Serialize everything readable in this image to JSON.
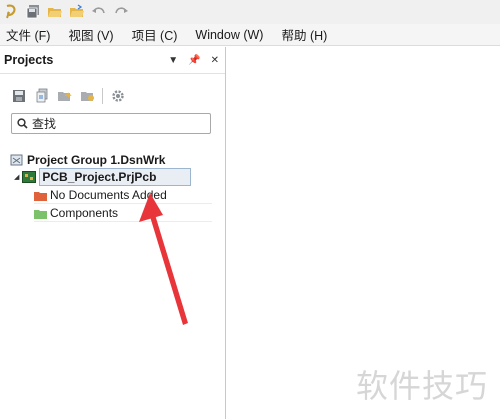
{
  "menubar": {
    "items": [
      {
        "label": "文件 (F)"
      },
      {
        "label": "视图 (V)"
      },
      {
        "label": "项目 (C)"
      },
      {
        "label": "Window (W)"
      },
      {
        "label": "帮助 (H)"
      }
    ]
  },
  "projects_panel": {
    "title": "Projects",
    "search": {
      "value": "查找"
    },
    "tree": {
      "group": "Project Group 1.DsnWrk",
      "project": "PCB_Project.PrjPcb",
      "folders": [
        {
          "label": "No Documents Added",
          "color": "#e0623a"
        },
        {
          "label": "Components",
          "color": "#7cc26a"
        }
      ]
    }
  },
  "annotation": {
    "arrow_color": "#e8353a"
  },
  "watermark": {
    "text": "软件技巧"
  }
}
